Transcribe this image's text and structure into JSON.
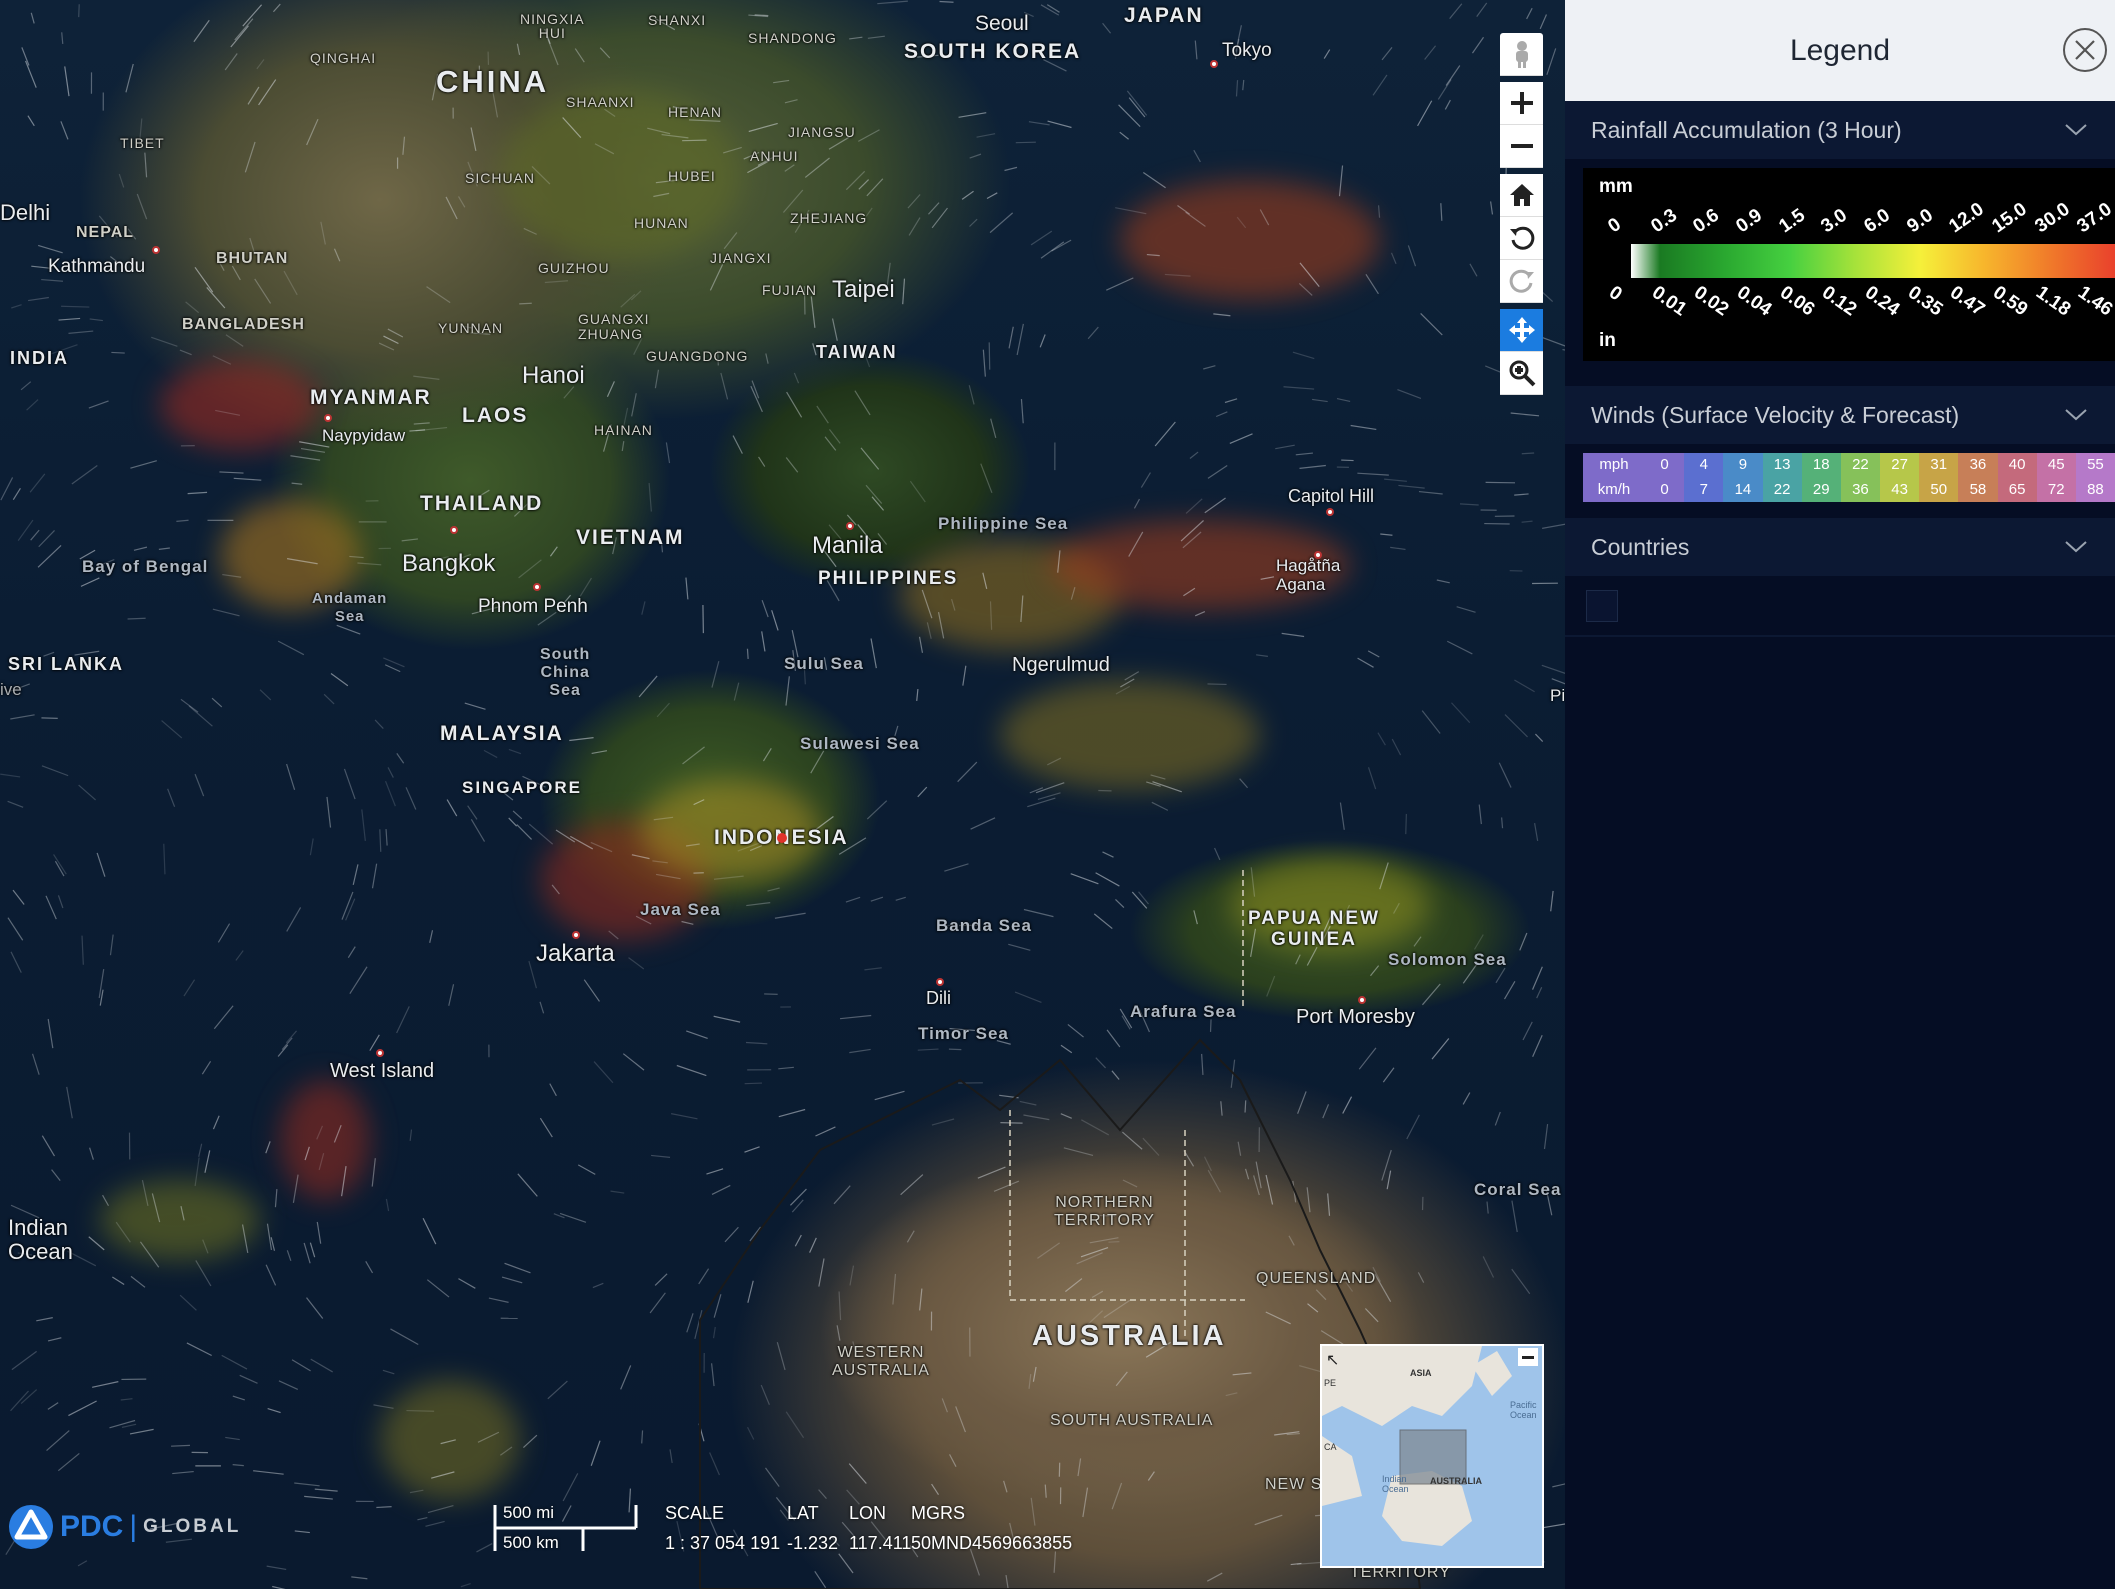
{
  "map": {
    "labels": {
      "china": "CHINA",
      "japan": "JAPAN",
      "seoul": "Seoul",
      "south_korea": "SOUTH KOREA",
      "tokyo": "Tokyo",
      "ningxia_hui": "NINGXIA\nHUI",
      "shanxi": "SHANXI",
      "shandong": "SHANDONG",
      "qinghai": "QINGHAI",
      "shaanxi": "SHAANXI",
      "henan": "HENAN",
      "jiangsu": "JIANGSU",
      "anhui": "ANHUI",
      "tibet": "TIBET",
      "sichuan": "SICHUAN",
      "hubei": "HUBEI",
      "zhejiang": "ZHEJIANG",
      "delhi": "Delhi",
      "nepal": "NEPAL",
      "hunan": "HUNAN",
      "kathmandu": "Kathmandu",
      "bhutan": "BHUTAN",
      "guizhou": "GUIZHOU",
      "jiangxi": "JIANGXI",
      "fujian": "FUJIAN",
      "taipei": "Taipei",
      "bangladesh": "BANGLADESH",
      "yunnan": "YUNNAN",
      "guangxi": "GUANGXI\nZHUANG",
      "guangdong": "GUANGDONG",
      "india": "INDIA",
      "taiwan": "TAIWAN",
      "hanoi": "Hanoi",
      "myanmar": "MYANMAR",
      "laos": "LAOS",
      "naypyidaw": "Naypyidaw",
      "hainan": "HAINAN",
      "thailand": "THAILAND",
      "vietnam": "VIETNAM",
      "philippine_sea": "Philippine Sea",
      "capitol_hill": "Capitol Hill",
      "bay_of_bengal": "Bay of Bengal",
      "bangkok": "Bangkok",
      "manila": "Manila",
      "philippines": "PHILIPPINES",
      "hagatna": "Hagåtña\nAgana",
      "andaman_sea": "Andaman\nSea",
      "phnom_penh": "Phnom Penh",
      "sri_lanka": "SRI LANKA",
      "ive": "ive",
      "south_china_sea": "South\nChina\nSea",
      "sulu_sea": "Sulu Sea",
      "ngerulmud": "Ngerulmud",
      "pi": "Pi",
      "malaysia": "MALAYSIA",
      "sulawesi_sea": "Sulawesi Sea",
      "singapore": "SINGAPORE",
      "indonesia": "INDONESIA",
      "papua_new_guinea": "PAPUA NEW\nGUINEA",
      "java_sea": "Java Sea",
      "banda_sea": "Banda Sea",
      "solomon_sea": "Solomon Sea",
      "jakarta": "Jakarta",
      "dili": "Dili",
      "arafura_sea": "Arafura Sea",
      "port_moresby": "Port Moresby",
      "timor_sea": "Timor Sea",
      "west_island": "West Island",
      "coral_sea": "Coral Sea",
      "northern_territory": "NORTHERN\nTERRITORY",
      "indian_ocean": "Indian\nOcean",
      "queensland": "QUEENSLAND",
      "australia": "AUSTRALIA",
      "western_australia": "WESTERN\nAUSTRALIA",
      "south_australia": "SOUTH AUSTRALIA",
      "new_s": "NEW S",
      "territory": "TERRITORY"
    },
    "toolbar": {
      "pegman": "person-icon",
      "zoom_in": "plus-icon",
      "zoom_out": "minus-icon",
      "home": "home-icon",
      "rotate_left": "rotate-left-icon",
      "rotate_right": "rotate-right-icon",
      "pan": "move-icon",
      "zoom_box": "zoom-box-icon"
    },
    "overview": {
      "asia": "ASIA",
      "pacific": "Pacific\nOcean",
      "indian": "Indian\nOcean",
      "australia": "AUSTRALIA",
      "pe": "PE",
      "ca": "CA"
    }
  },
  "footer": {
    "logo_text": "PDC",
    "logo_sub": "GLOBAL",
    "scale_mi": "500 mi",
    "scale_km": "500 km",
    "scale_label": "SCALE",
    "scale_value": "1 : 37 054 191",
    "lat_label": "LAT",
    "lat_value": "-1.232",
    "lon_label": "LON",
    "lon_value": "117.411",
    "mgrs_label": "MGRS",
    "mgrs_value": "50MND4569663855"
  },
  "legend": {
    "title": "Legend",
    "close_icon": "close-icon",
    "rainfall": {
      "title": "Rainfall Accumulation (3 Hour)",
      "unit_top": "mm",
      "unit_bottom": "in",
      "mm_values": [
        "0",
        "0.3",
        "0.6",
        "0.9",
        "1.5",
        "3.0",
        "6.0",
        "9.0",
        "12.0",
        "15.0",
        "30.0",
        "37.0"
      ],
      "in_values": [
        "0",
        "0.01",
        "0.02",
        "0.04",
        "0.06",
        "0.12",
        "0.24",
        "0.35",
        "0.47",
        "0.59",
        "1.18",
        "1.46"
      ],
      "gradient_colors": [
        "#ffffff",
        "#1a7a22",
        "#2aa830",
        "#46d040",
        "#a6e23a",
        "#f5f03a",
        "#f7b52c",
        "#f07a2a",
        "#e9412c"
      ]
    },
    "winds": {
      "title": "Winds (Surface Velocity & Forecast)",
      "mph_label": "mph",
      "kmh_label": "km/h",
      "mph": [
        "0",
        "4",
        "9",
        "13",
        "18",
        "22",
        "27",
        "31",
        "36",
        "40",
        "45",
        "55"
      ],
      "kmh": [
        "0",
        "7",
        "14",
        "22",
        "29",
        "36",
        "43",
        "50",
        "58",
        "65",
        "72",
        "88"
      ],
      "colors": [
        "#7e6bc9",
        "#5b6fd0",
        "#4a8bc8",
        "#4aa3a4",
        "#55b178",
        "#86c15a",
        "#b6c74a",
        "#c7a447",
        "#c77f58",
        "#c46a7c",
        "#c471a6",
        "#b579c9"
      ]
    },
    "countries": {
      "title": "Countries"
    }
  }
}
